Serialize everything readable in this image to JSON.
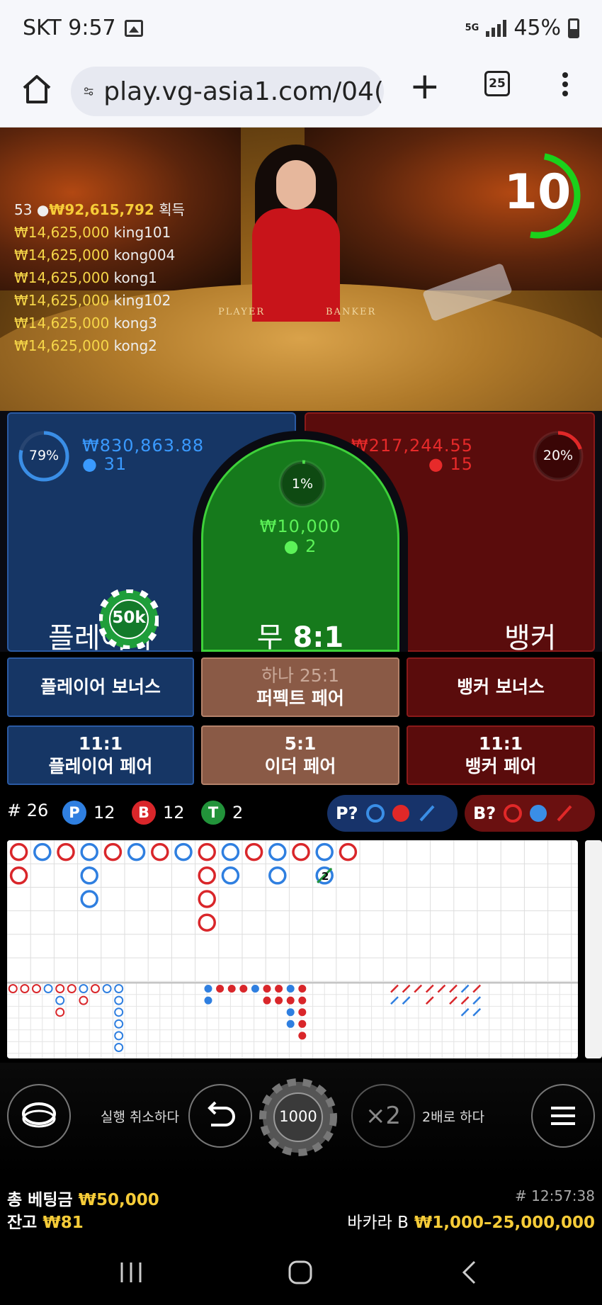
{
  "status": {
    "carrier_time": "SKT 9:57",
    "network": "5G",
    "battery": "45%"
  },
  "browser": {
    "url": "play.vg-asia1.com/04(",
    "tab_count": "25"
  },
  "video": {
    "timer": "10",
    "table_label_player": "PLAYER",
    "table_label_banker": "BANKER",
    "winners_header": {
      "count": "53",
      "amount": "₩92,615,792",
      "suffix": "획득"
    },
    "winners": [
      {
        "amount": "₩14,625,000",
        "name": "king101"
      },
      {
        "amount": "₩14,625,000",
        "name": "kong004"
      },
      {
        "amount": "₩14,625,000",
        "name": "kong1"
      },
      {
        "amount": "₩14,625,000",
        "name": "king102"
      },
      {
        "amount": "₩14,625,000",
        "name": "kong3"
      },
      {
        "amount": "₩14,625,000",
        "name": "kong2"
      }
    ]
  },
  "bets": {
    "player": {
      "label": "플레이어",
      "pct": "79%",
      "amount": "₩830,863.88",
      "count": "31",
      "chip": "50k",
      "fill": 0.79,
      "color": "#3a8ee6"
    },
    "tie": {
      "label_prefix": "무",
      "label_odds": "8:1",
      "pct": "1%",
      "amount": "₩10,000",
      "count": "2",
      "fill": 0.01,
      "color": "#4ee04a"
    },
    "banker": {
      "label": "뱅커",
      "pct": "20%",
      "amount": "₩217,244.55",
      "count": "15",
      "fill": 0.2,
      "color": "#e02828"
    }
  },
  "side_bets": {
    "player_bonus": "플레이어 보너스",
    "perfect_pair_odds": "하나 25:1",
    "perfect_pair": "퍼펙트 페어",
    "banker_bonus": "뱅커 보너스",
    "player_pair_odds": "11:1",
    "player_pair": "플레이어 페어",
    "either_pair_odds": "5:1",
    "either_pair": "이더 페어",
    "banker_pair_odds": "11:1",
    "banker_pair": "뱅커 페어"
  },
  "stats": {
    "round": "# 26",
    "p_badge": "P",
    "p_count": "12",
    "b_badge": "B",
    "b_count": "12",
    "t_badge": "T",
    "t_count": "2",
    "p_predict": "P?",
    "b_predict": "B?"
  },
  "roads": {
    "big_road": [
      [
        "B",
        "B"
      ],
      [
        "P"
      ],
      [
        "B"
      ],
      [
        "P",
        "P",
        "P"
      ],
      [
        "B"
      ],
      [
        "P"
      ],
      [
        "B"
      ],
      [
        "P"
      ],
      [
        "B",
        "B",
        "B",
        "B"
      ],
      [
        "P",
        "P"
      ],
      [
        "B"
      ],
      [
        "P",
        "P"
      ],
      [
        "B"
      ],
      [
        "P",
        "Pt"
      ],
      [
        "B"
      ]
    ],
    "tie_mark": "2"
  },
  "controls": {
    "undo_label": "실행 취소하다",
    "chip_value": "1000",
    "double_icon": "×2",
    "double_label": "2배로 하다"
  },
  "footer": {
    "total_bet_label": "총 베팅금",
    "total_bet": "₩50,000",
    "balance_label": "잔고",
    "balance": "₩81",
    "round_id": "# 12:57:38",
    "limits_label": "바카라 B",
    "limits": "₩1,000–25,000,000"
  }
}
